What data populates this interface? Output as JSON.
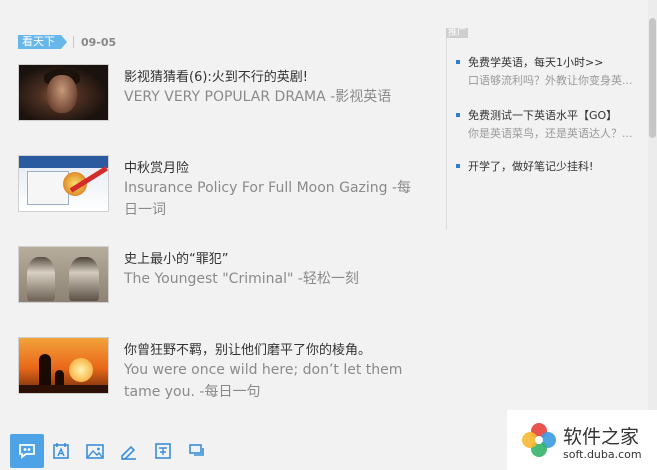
{
  "header": {
    "tag": "看天下",
    "date": "09-05"
  },
  "articles": [
    {
      "title": "影视猜猜看(6):火到不行的英剧!",
      "subtitle": "VERY VERY POPULAR DRAMA -影视英语"
    },
    {
      "title": "中秋赏月险",
      "subtitle": "Insurance Policy For Full Moon Gazing -每日一词"
    },
    {
      "title": "史上最小的“罪犯”",
      "subtitle": "The Youngest \"Criminal\" -轻松一刻"
    },
    {
      "title": "你曾狂野不羁，别让他们磨平了你的棱角。",
      "subtitle": "You were once wild here; don’t let them tame you. -每日一句"
    }
  ],
  "sidebar": {
    "ad_label": "推广",
    "items": [
      {
        "title": "免费学英语，每天1小时>>",
        "subtitle": "口语够流利吗？外教让你变身英..."
      },
      {
        "title": "免费测试一下英语水平【GO】",
        "subtitle": "你是英语菜鸟，还是英语达人？..."
      },
      {
        "title": "开学了，做好笔记少挂科!",
        "subtitle": ""
      }
    ]
  },
  "toolbar": {
    "icons": [
      "translate-home-icon",
      "calendar-word-icon",
      "image-word-icon",
      "pen-icon",
      "translate-icon",
      "chat-icon"
    ]
  },
  "watermark": {
    "name": "软件之家",
    "url": "soft.duba.com"
  },
  "colors": {
    "accent": "#4ea3e6",
    "tag": "#68b7eb",
    "bullet": "#2a7fd0"
  }
}
